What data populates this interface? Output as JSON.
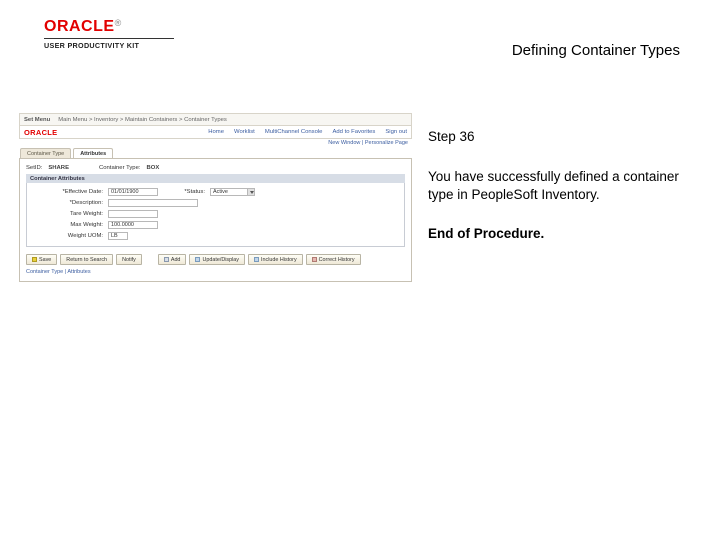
{
  "header": {
    "brand": "ORACLE",
    "reg": "®",
    "subline": "USER PRODUCTIVITY KIT",
    "title": "Defining Container Types"
  },
  "instructions": {
    "step_label": "Step 36",
    "body": "You have successfully defined a container type in PeopleSoft Inventory.",
    "end": "End of Procedure."
  },
  "shot": {
    "topbar": {
      "label": "Set Menu",
      "path": "Main Menu > Inventory > Maintain Containers > Container Types",
      "help1": "Home",
      "help2": "Worklist",
      "help3": "Add to Favorites",
      "help4": "Sign out"
    },
    "orabar": {
      "brand": "ORACLE",
      "nav1": "Home",
      "nav2": "Worklist",
      "nav3": "MultiChannel Console",
      "nav4": "Add to Favorites",
      "nav5": "Sign out"
    },
    "newwin": "New Window | Personalize Page",
    "tabs": {
      "t1": "Container Type",
      "t2": "Attributes"
    },
    "form": {
      "setid_l": "SetID:",
      "setid_v": "SHARE",
      "ctype_l": "Container Type:",
      "ctype_v": "BOX",
      "section": "Container Attributes",
      "effdate_l": "*Effective Date:",
      "effdate_v": "01/01/1900",
      "status_l": "*Status:",
      "status_v": "Active",
      "desc_l": "*Description:",
      "tare_l": "Tare Weight:",
      "max_l": "Max Weight:",
      "max_v": "100.0000",
      "wuom_l": "Weight UOM:",
      "wuom_v": "LB"
    },
    "buttons": {
      "save": "Save",
      "return": "Return to Search",
      "notify": "Notify",
      "add": "Add",
      "updd": "Update/Display",
      "inch": "Include History",
      "corr": "Correct History"
    },
    "footer": "Container Type | Attributes"
  }
}
